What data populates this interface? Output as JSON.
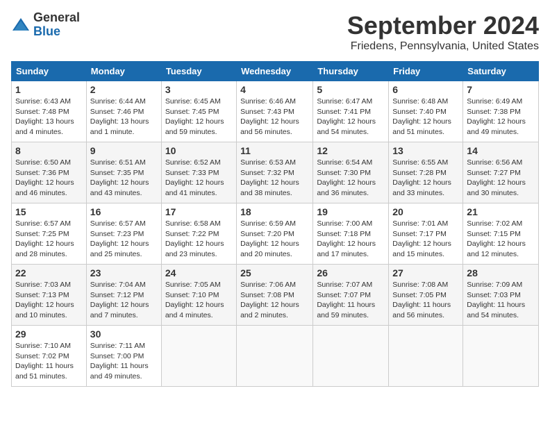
{
  "logo": {
    "general": "General",
    "blue": "Blue"
  },
  "title": "September 2024",
  "location": "Friedens, Pennsylvania, United States",
  "headers": [
    "Sunday",
    "Monday",
    "Tuesday",
    "Wednesday",
    "Thursday",
    "Friday",
    "Saturday"
  ],
  "weeks": [
    [
      {
        "day": "1",
        "sunrise": "Sunrise: 6:43 AM",
        "sunset": "Sunset: 7:48 PM",
        "daylight": "Daylight: 13 hours and 4 minutes."
      },
      {
        "day": "2",
        "sunrise": "Sunrise: 6:44 AM",
        "sunset": "Sunset: 7:46 PM",
        "daylight": "Daylight: 13 hours and 1 minute."
      },
      {
        "day": "3",
        "sunrise": "Sunrise: 6:45 AM",
        "sunset": "Sunset: 7:45 PM",
        "daylight": "Daylight: 12 hours and 59 minutes."
      },
      {
        "day": "4",
        "sunrise": "Sunrise: 6:46 AM",
        "sunset": "Sunset: 7:43 PM",
        "daylight": "Daylight: 12 hours and 56 minutes."
      },
      {
        "day": "5",
        "sunrise": "Sunrise: 6:47 AM",
        "sunset": "Sunset: 7:41 PM",
        "daylight": "Daylight: 12 hours and 54 minutes."
      },
      {
        "day": "6",
        "sunrise": "Sunrise: 6:48 AM",
        "sunset": "Sunset: 7:40 PM",
        "daylight": "Daylight: 12 hours and 51 minutes."
      },
      {
        "day": "7",
        "sunrise": "Sunrise: 6:49 AM",
        "sunset": "Sunset: 7:38 PM",
        "daylight": "Daylight: 12 hours and 49 minutes."
      }
    ],
    [
      {
        "day": "8",
        "sunrise": "Sunrise: 6:50 AM",
        "sunset": "Sunset: 7:36 PM",
        "daylight": "Daylight: 12 hours and 46 minutes."
      },
      {
        "day": "9",
        "sunrise": "Sunrise: 6:51 AM",
        "sunset": "Sunset: 7:35 PM",
        "daylight": "Daylight: 12 hours and 43 minutes."
      },
      {
        "day": "10",
        "sunrise": "Sunrise: 6:52 AM",
        "sunset": "Sunset: 7:33 PM",
        "daylight": "Daylight: 12 hours and 41 minutes."
      },
      {
        "day": "11",
        "sunrise": "Sunrise: 6:53 AM",
        "sunset": "Sunset: 7:32 PM",
        "daylight": "Daylight: 12 hours and 38 minutes."
      },
      {
        "day": "12",
        "sunrise": "Sunrise: 6:54 AM",
        "sunset": "Sunset: 7:30 PM",
        "daylight": "Daylight: 12 hours and 36 minutes."
      },
      {
        "day": "13",
        "sunrise": "Sunrise: 6:55 AM",
        "sunset": "Sunset: 7:28 PM",
        "daylight": "Daylight: 12 hours and 33 minutes."
      },
      {
        "day": "14",
        "sunrise": "Sunrise: 6:56 AM",
        "sunset": "Sunset: 7:27 PM",
        "daylight": "Daylight: 12 hours and 30 minutes."
      }
    ],
    [
      {
        "day": "15",
        "sunrise": "Sunrise: 6:57 AM",
        "sunset": "Sunset: 7:25 PM",
        "daylight": "Daylight: 12 hours and 28 minutes."
      },
      {
        "day": "16",
        "sunrise": "Sunrise: 6:57 AM",
        "sunset": "Sunset: 7:23 PM",
        "daylight": "Daylight: 12 hours and 25 minutes."
      },
      {
        "day": "17",
        "sunrise": "Sunrise: 6:58 AM",
        "sunset": "Sunset: 7:22 PM",
        "daylight": "Daylight: 12 hours and 23 minutes."
      },
      {
        "day": "18",
        "sunrise": "Sunrise: 6:59 AM",
        "sunset": "Sunset: 7:20 PM",
        "daylight": "Daylight: 12 hours and 20 minutes."
      },
      {
        "day": "19",
        "sunrise": "Sunrise: 7:00 AM",
        "sunset": "Sunset: 7:18 PM",
        "daylight": "Daylight: 12 hours and 17 minutes."
      },
      {
        "day": "20",
        "sunrise": "Sunrise: 7:01 AM",
        "sunset": "Sunset: 7:17 PM",
        "daylight": "Daylight: 12 hours and 15 minutes."
      },
      {
        "day": "21",
        "sunrise": "Sunrise: 7:02 AM",
        "sunset": "Sunset: 7:15 PM",
        "daylight": "Daylight: 12 hours and 12 minutes."
      }
    ],
    [
      {
        "day": "22",
        "sunrise": "Sunrise: 7:03 AM",
        "sunset": "Sunset: 7:13 PM",
        "daylight": "Daylight: 12 hours and 10 minutes."
      },
      {
        "day": "23",
        "sunrise": "Sunrise: 7:04 AM",
        "sunset": "Sunset: 7:12 PM",
        "daylight": "Daylight: 12 hours and 7 minutes."
      },
      {
        "day": "24",
        "sunrise": "Sunrise: 7:05 AM",
        "sunset": "Sunset: 7:10 PM",
        "daylight": "Daylight: 12 hours and 4 minutes."
      },
      {
        "day": "25",
        "sunrise": "Sunrise: 7:06 AM",
        "sunset": "Sunset: 7:08 PM",
        "daylight": "Daylight: 12 hours and 2 minutes."
      },
      {
        "day": "26",
        "sunrise": "Sunrise: 7:07 AM",
        "sunset": "Sunset: 7:07 PM",
        "daylight": "Daylight: 11 hours and 59 minutes."
      },
      {
        "day": "27",
        "sunrise": "Sunrise: 7:08 AM",
        "sunset": "Sunset: 7:05 PM",
        "daylight": "Daylight: 11 hours and 56 minutes."
      },
      {
        "day": "28",
        "sunrise": "Sunrise: 7:09 AM",
        "sunset": "Sunset: 7:03 PM",
        "daylight": "Daylight: 11 hours and 54 minutes."
      }
    ],
    [
      {
        "day": "29",
        "sunrise": "Sunrise: 7:10 AM",
        "sunset": "Sunset: 7:02 PM",
        "daylight": "Daylight: 11 hours and 51 minutes."
      },
      {
        "day": "30",
        "sunrise": "Sunrise: 7:11 AM",
        "sunset": "Sunset: 7:00 PM",
        "daylight": "Daylight: 11 hours and 49 minutes."
      },
      null,
      null,
      null,
      null,
      null
    ]
  ]
}
